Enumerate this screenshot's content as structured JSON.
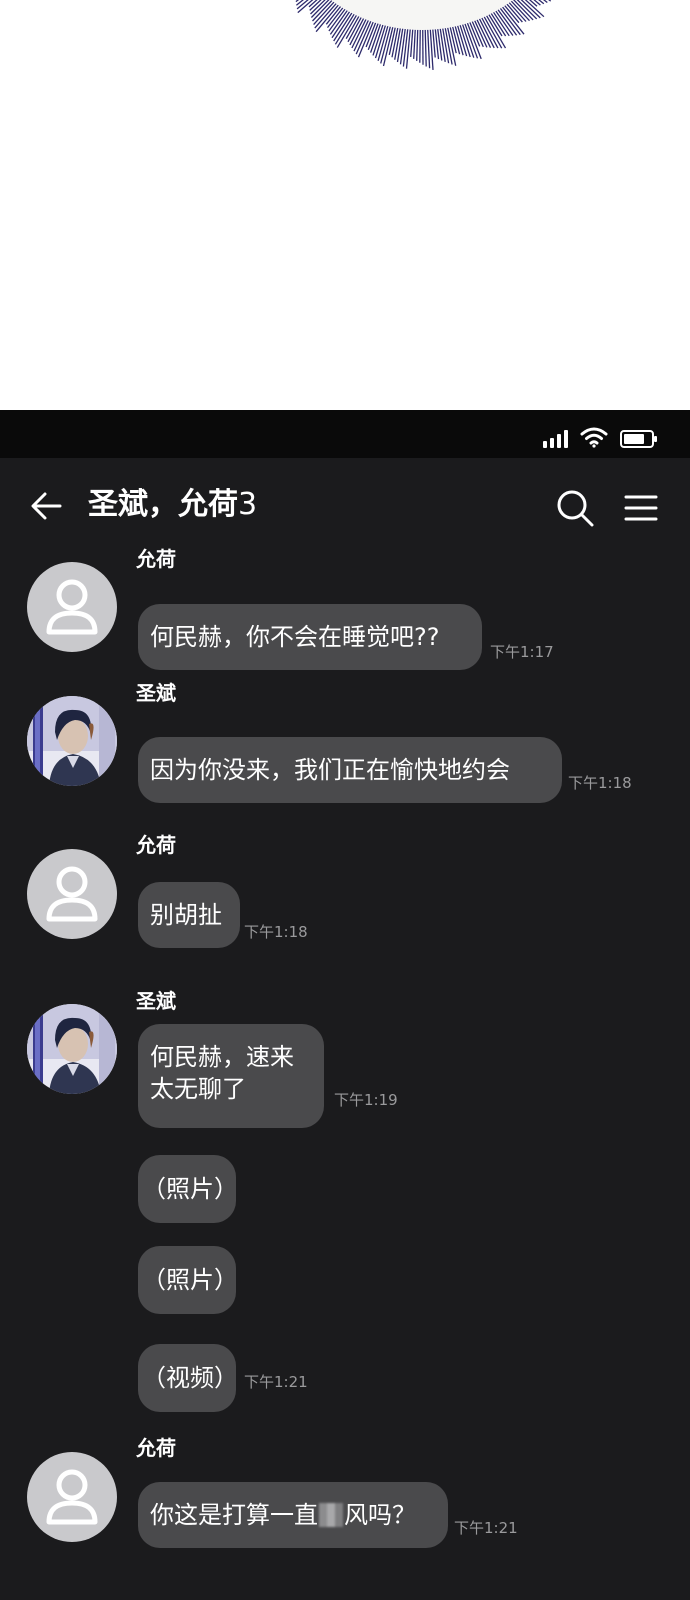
{
  "colors": {
    "screen_bg": "#1b1b1d",
    "status_bar_bg": "#0a0a0a",
    "bubble_bg": "#4a4a4c",
    "timestamp": "#9a9a9c",
    "default_avatar_bg": "#c9c9cc",
    "burst_lines": "#2d2a6b"
  },
  "header": {
    "title": "圣斌，允荷",
    "member_count": "3",
    "back_icon": "arrow-left-icon",
    "search_icon": "search-icon",
    "menu_icon": "hamburger-menu-icon"
  },
  "status_bar": {
    "icons": [
      "signal-icon",
      "wifi-icon",
      "battery-icon"
    ]
  },
  "messages": [
    {
      "sender": "允荷",
      "avatar": "default-user-icon",
      "text": "何民赫，你不会在睡觉吧??",
      "time": "下午1:17"
    },
    {
      "sender": "圣斌",
      "avatar": "user-photo-icon",
      "text": "因为你没来，我们正在愉快地约会",
      "time": "下午1:18"
    },
    {
      "sender": "允荷",
      "avatar": "default-user-icon",
      "text": "别胡扯",
      "time": "下午1:18"
    },
    {
      "sender": "圣斌",
      "avatar": "user-photo-icon",
      "text_line1": "何民赫，速来",
      "text_line2": "太无聊了",
      "time": "下午1:19"
    },
    {
      "text": "（照片）"
    },
    {
      "text": "（照片）"
    },
    {
      "text": "（视频）",
      "time": "下午1:21"
    },
    {
      "sender": "允荷",
      "avatar": "default-user-icon",
      "text_before": "你这是打算一直",
      "text_after": "风吗？",
      "time": "下午1:21"
    }
  ]
}
